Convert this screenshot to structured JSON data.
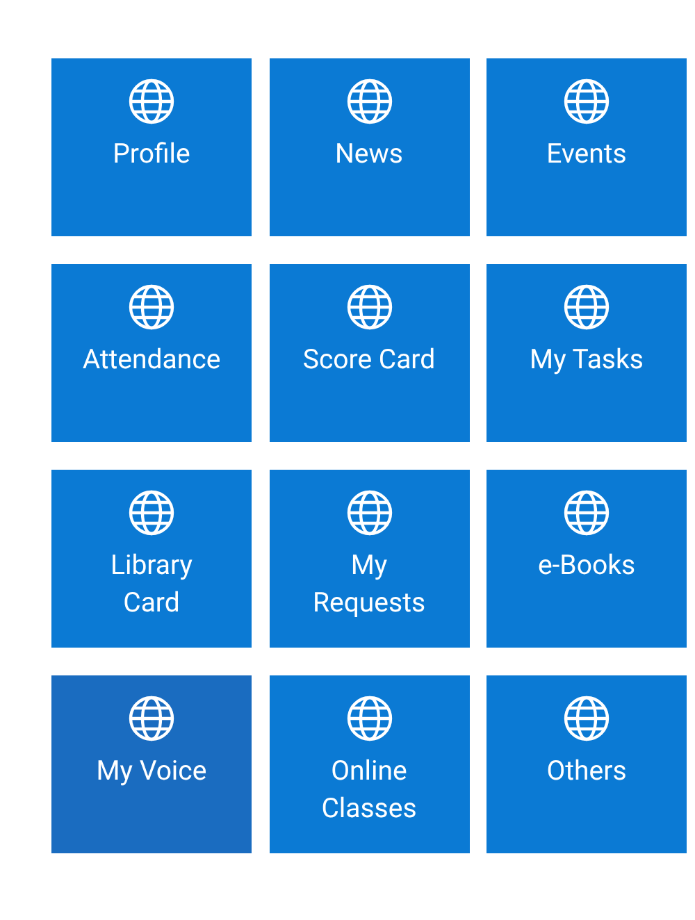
{
  "tiles": [
    {
      "label": "Profile",
      "selected": false
    },
    {
      "label": "News",
      "selected": false
    },
    {
      "label": "Events",
      "selected": false
    },
    {
      "label": "Attendance",
      "selected": false
    },
    {
      "label": "Score Card",
      "selected": false
    },
    {
      "label": "My Tasks",
      "selected": false
    },
    {
      "label": "Library\nCard",
      "selected": false
    },
    {
      "label": "My\nRequests",
      "selected": false
    },
    {
      "label": "e-Books",
      "selected": false
    },
    {
      "label": "My Voice",
      "selected": true
    },
    {
      "label": "Online\nClasses",
      "selected": false
    },
    {
      "label": "Others",
      "selected": false
    }
  ]
}
